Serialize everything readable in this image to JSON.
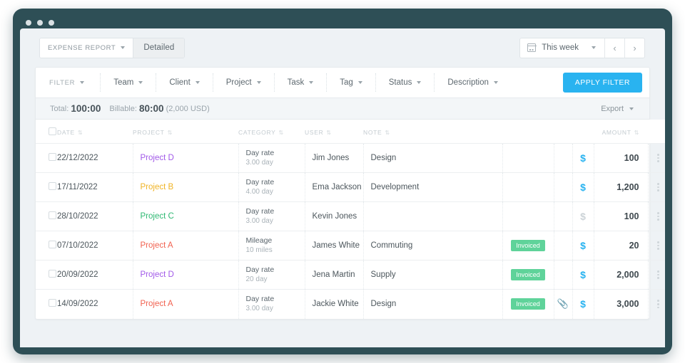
{
  "window": {
    "dots": [
      "close",
      "minimize",
      "maximize"
    ]
  },
  "toolbar": {
    "report_type": "EXPENSE REPORT",
    "view_tab": "Detailed",
    "date_range": "This week",
    "calendar_icon": "calendar-icon",
    "prev_label": "‹",
    "next_label": "›"
  },
  "filters": {
    "label": "FILTER",
    "items": [
      {
        "label": "Team"
      },
      {
        "label": "Client"
      },
      {
        "label": "Project"
      },
      {
        "label": "Task"
      },
      {
        "label": "Tag"
      },
      {
        "label": "Status"
      },
      {
        "label": "Description"
      }
    ],
    "apply_label": "APPLY FILTER"
  },
  "totals": {
    "total_label": "Total:",
    "total_value": "100:00",
    "billable_label": "Billable:",
    "billable_value": "80:00",
    "currency": "(2,000 USD)",
    "export_label": "Export"
  },
  "table": {
    "columns": [
      {
        "key": "date",
        "label": "DATE",
        "sortable": true
      },
      {
        "key": "project",
        "label": "PROJECT",
        "sortable": true
      },
      {
        "key": "category",
        "label": "CATEGORY",
        "sortable": true
      },
      {
        "key": "user",
        "label": "USER",
        "sortable": true
      },
      {
        "key": "note",
        "label": "NOTE",
        "sortable": true
      },
      {
        "key": "amount",
        "label": "AMOUNT",
        "sortable": true
      }
    ],
    "sort_glyph": "⇅",
    "rows": [
      {
        "date": "22/12/2022",
        "project": "Project D",
        "project_color": "#a158e8",
        "category": "Day rate",
        "quantity": "3.00 day",
        "user": "Jim Jones",
        "note": "Design",
        "status": "",
        "attachment": false,
        "billable": true,
        "amount": "100"
      },
      {
        "date": "17/11/2022",
        "project": "Project B",
        "project_color": "#f0b323",
        "category": "Day rate",
        "quantity": "4.00 day",
        "user": "Ema Jackson",
        "note": "Development",
        "status": "",
        "attachment": false,
        "billable": true,
        "amount": "1,200"
      },
      {
        "date": "28/10/2022",
        "project": "Project C",
        "project_color": "#2eb872",
        "category": "Day rate",
        "quantity": "3.00 day",
        "user": "Kevin Jones",
        "note": "",
        "status": "",
        "attachment": false,
        "billable": false,
        "amount": "100"
      },
      {
        "date": "07/10/2022",
        "project": "Project A",
        "project_color": "#f1614f",
        "category": "Mileage",
        "quantity": "10 miles",
        "user": "James White",
        "note": "Commuting",
        "status": "Invoiced",
        "attachment": false,
        "billable": true,
        "amount": "20"
      },
      {
        "date": "20/09/2022",
        "project": "Project D",
        "project_color": "#a158e8",
        "category": "Day rate",
        "quantity": "20 day",
        "user": "Jena Martin",
        "note": "Supply",
        "status": "Invoiced",
        "attachment": false,
        "billable": true,
        "amount": "2,000"
      },
      {
        "date": "14/09/2022",
        "project": "Project A",
        "project_color": "#f1614f",
        "category": "Day rate",
        "quantity": "3.00 day",
        "user": "Jackie White",
        "note": "Design",
        "status": "Invoiced",
        "attachment": true,
        "billable": true,
        "amount": "3,000"
      }
    ]
  },
  "colors": {
    "accent": "#29b3f0",
    "badge_green": "#5fd39a",
    "frame": "#2e4f56",
    "app_bg": "#eef2f5"
  }
}
